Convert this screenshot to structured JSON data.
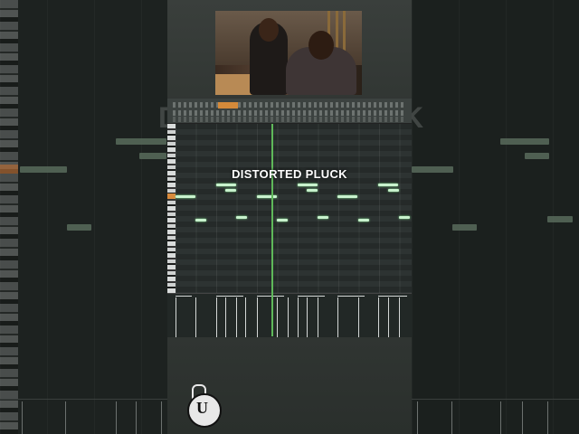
{
  "video": {
    "caption": "DISTORTED PLUCK",
    "accent_note_color": "#c8f2cd",
    "playhead_color": "#5fb85a"
  },
  "daw": {
    "toolbar_accent": "#d48a3a",
    "piano_roll_notes_count": 18
  },
  "icons": {
    "logo": "u-disc-logo-icon",
    "webcam": "webcam-feed"
  }
}
